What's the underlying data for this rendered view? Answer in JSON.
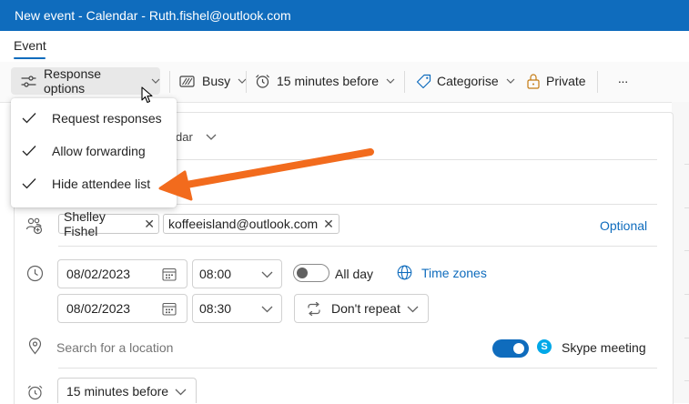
{
  "window": {
    "title": "New event - Calendar - Ruth.fishel@outlook.com"
  },
  "tabs": [
    {
      "label": "Event"
    }
  ],
  "toolbar": {
    "response_options": "Response options",
    "busy": "Busy",
    "reminder": "15 minutes before",
    "categorise": "Categorise",
    "private": "Private",
    "more": "···"
  },
  "response_menu": {
    "items": [
      {
        "label": "Request responses",
        "checked": true
      },
      {
        "label": "Allow forwarding",
        "checked": true
      },
      {
        "label": "Hide attendee list",
        "checked": true
      }
    ]
  },
  "calendar_select": {
    "label_fragment": "dar"
  },
  "attendees": {
    "chips": [
      {
        "label": "Shelley Fishel"
      },
      {
        "label": "koffeeisland@outlook.com"
      }
    ],
    "optional": "Optional"
  },
  "schedule": {
    "start_date": "08/02/2023",
    "start_time": "08:00",
    "end_date": "08/02/2023",
    "end_time": "08:30",
    "all_day_label": "All day",
    "all_day_on": false,
    "time_zones": "Time zones",
    "repeat": "Don't repeat"
  },
  "location": {
    "placeholder": "Search for a location",
    "skype_label": "Skype meeting",
    "skype_on": true
  },
  "reminder_field": {
    "value": "15 minutes before"
  },
  "colors": {
    "accent": "#0f6cbd",
    "annotation_arrow": "#f26b1d",
    "skype": "#00a8e8"
  }
}
